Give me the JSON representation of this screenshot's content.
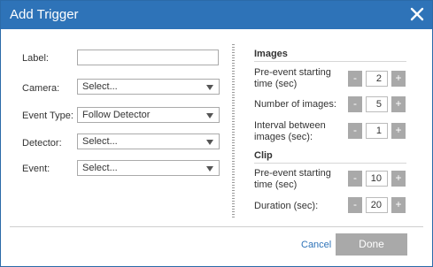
{
  "dialog": {
    "title": "Add Trigger",
    "close_icon": "close-icon"
  },
  "form": {
    "label": {
      "label": "Label:",
      "value": ""
    },
    "camera": {
      "label": "Camera:",
      "value": "Select..."
    },
    "event_type": {
      "label": "Event Type:",
      "value": "Follow Detector"
    },
    "detector": {
      "label": "Detector:",
      "value": "Select..."
    },
    "event": {
      "label": "Event:",
      "value": "Select..."
    }
  },
  "images": {
    "heading": "Images",
    "pre_event_label": "Pre-event starting time (sec)",
    "pre_event_value": "2",
    "num_images_label": "Number of images:",
    "num_images_value": "5",
    "interval_label": "Interval between images (sec):",
    "interval_value": "1"
  },
  "clip": {
    "heading": "Clip",
    "pre_event_label": "Pre-event starting time (sec)",
    "pre_event_value": "10",
    "duration_label": "Duration (sec):",
    "duration_value": "20"
  },
  "stepper": {
    "minus": "-",
    "plus": "+"
  },
  "footer": {
    "cancel": "Cancel",
    "done": "Done"
  },
  "colors": {
    "title_bar": "#2e73b8",
    "button_gray": "#a9a9a9",
    "link": "#2e73b8"
  }
}
